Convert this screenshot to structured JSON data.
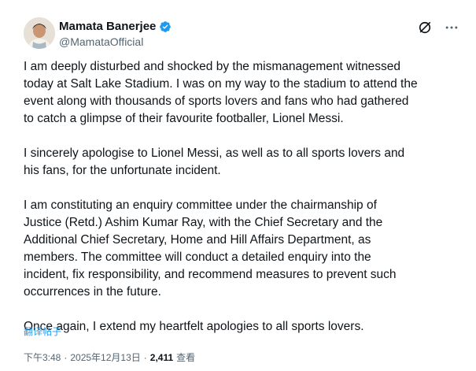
{
  "author": {
    "display_name": "Mamata Banerjee",
    "handle": "@MamataOfficial",
    "verified_color": "#1d9bf0"
  },
  "icons": {
    "grok": "grok-icon",
    "more": "more-icon"
  },
  "tweet": {
    "paragraphs": [
      "I am deeply disturbed and shocked by the mismanagement witnessed\ntoday at Salt Lake Stadium. I was on my way to the stadium to attend the\nevent along with thousands of sports lovers and fans who had gathered\nto catch a glimpse of their favourite footballer, Lionel Messi.",
      "I sincerely apologise to Lionel Messi, as well as to all sports lovers and\nhis fans, for the unfortunate incident.",
      "I am constituting an enquiry committee under the chairmanship of\nJustice (Retd.) Ashim Kumar Ray, with the Chief Secretary and the\nAdditional Chief Secretary, Home and Hill Affairs Department, as\nmembers. The committee will conduct a detailed enquiry into the\nincident, fix responsibility, and recommend measures to prevent such\noccurrences in the future.",
      "Once again, I extend my heartfelt apologies to all sports lovers."
    ],
    "translate_label": "翻译帖子"
  },
  "meta": {
    "time": "下午3:48",
    "separator": "·",
    "date": "2025年12月13日",
    "separator2": "·",
    "views_count": "2,411",
    "views_label": "查看"
  }
}
